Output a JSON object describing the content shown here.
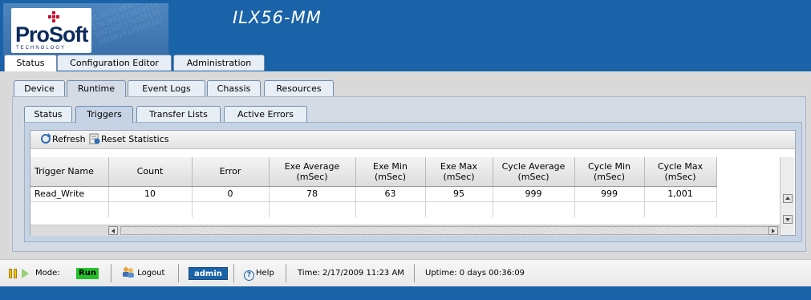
{
  "header": {
    "brand": "ProSoft",
    "brand_sub": "TECHNOLOGY",
    "product_title": "ILX56-MM",
    "brand_color": "#1b63a8"
  },
  "top_tabs": [
    {
      "label": "Status",
      "active": true
    },
    {
      "label": "Configuration Editor",
      "active": false
    },
    {
      "label": "Administration",
      "active": false
    }
  ],
  "level2_tabs": [
    {
      "label": "Device",
      "active": false
    },
    {
      "label": "Runtime",
      "active": true
    },
    {
      "label": "Event Logs",
      "active": false
    },
    {
      "label": "Chassis",
      "active": false
    },
    {
      "label": "Resources",
      "active": false
    }
  ],
  "level3_tabs": [
    {
      "label": "Status",
      "active": false
    },
    {
      "label": "Triggers",
      "active": true
    },
    {
      "label": "Transfer Lists",
      "active": false
    },
    {
      "label": "Active Errors",
      "active": false
    }
  ],
  "toolbar": {
    "refresh_label": "Refresh",
    "refresh_icon": "refresh-icon",
    "reset_label": "Reset Statistics",
    "reset_icon": "reset-statistics-icon"
  },
  "grid": {
    "columns": [
      {
        "line1": "Trigger Name",
        "line2": ""
      },
      {
        "line1": "Count",
        "line2": ""
      },
      {
        "line1": "Error",
        "line2": ""
      },
      {
        "line1": "Exe Average",
        "line2": "(mSec)"
      },
      {
        "line1": "Exe Min",
        "line2": "(mSec)"
      },
      {
        "line1": "Exe Max",
        "line2": "(mSec)"
      },
      {
        "line1": "Cycle Average",
        "line2": "(mSec)"
      },
      {
        "line1": "Cycle Min",
        "line2": "(mSec)"
      },
      {
        "line1": "Cycle Max",
        "line2": "(mSec)"
      }
    ],
    "rows": [
      [
        "Read_Write",
        "10",
        "0",
        "78",
        "63",
        "95",
        "999",
        "999",
        "1,001"
      ]
    ]
  },
  "status_bar": {
    "mode_label": "Mode:",
    "mode_value": "Run",
    "mode_color": "#22c22b",
    "logout_label": "Logout",
    "user": "admin",
    "help_label": "Help",
    "time": "Time: 2/17/2009 11:23 AM",
    "uptime": "Uptime: 0 days 00:36:09"
  }
}
